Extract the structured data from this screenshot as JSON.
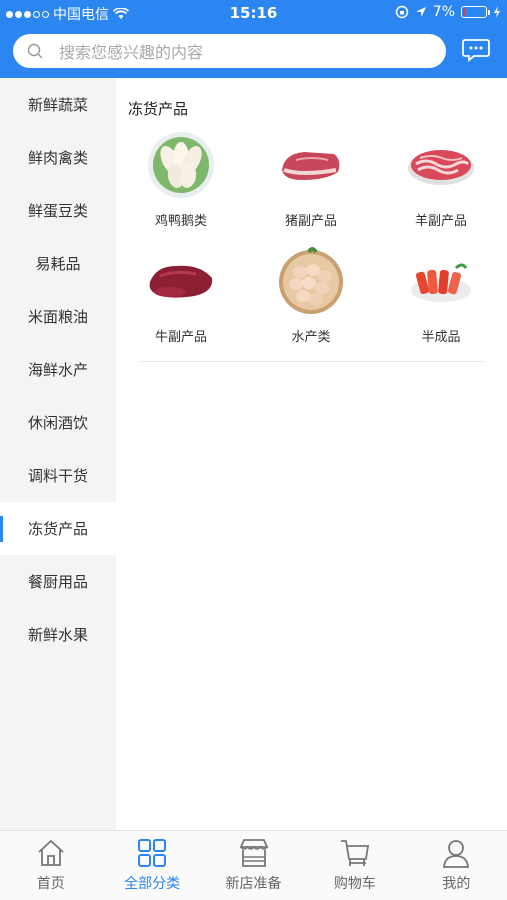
{
  "status_bar": {
    "carrier": "中国电信",
    "time": "15:16",
    "battery": "7%"
  },
  "search": {
    "placeholder": "搜索您感兴趣的内容"
  },
  "colors": {
    "primary": "#2b86f2",
    "sidebar_bg": "#f4f4f6"
  },
  "sidebar": {
    "items": [
      {
        "label": "新鲜蔬菜"
      },
      {
        "label": "鲜肉禽类"
      },
      {
        "label": "鲜蛋豆类"
      },
      {
        "label": "易耗品"
      },
      {
        "label": "米面粮油"
      },
      {
        "label": "海鲜水产"
      },
      {
        "label": "休闲酒饮"
      },
      {
        "label": "调料干货"
      },
      {
        "label": "冻货产品",
        "active": true
      },
      {
        "label": "餐厨用品"
      },
      {
        "label": "新鲜水果"
      }
    ]
  },
  "category": {
    "title": "冻货产品",
    "products": [
      {
        "label": "鸡鸭鹅类",
        "icon": "poultry-image"
      },
      {
        "label": "猪副产品",
        "icon": "pork-image"
      },
      {
        "label": "羊副产品",
        "icon": "mutton-image"
      },
      {
        "label": "牛副产品",
        "icon": "beef-image"
      },
      {
        "label": "水产类",
        "icon": "eggs-image"
      },
      {
        "label": "半成品",
        "icon": "semi-finished-image"
      }
    ]
  },
  "tabbar": {
    "tabs": [
      {
        "label": "首页",
        "icon": "home-icon"
      },
      {
        "label": "全部分类",
        "icon": "grid-icon",
        "active": true
      },
      {
        "label": "新店准备",
        "icon": "store-icon"
      },
      {
        "label": "购物车",
        "icon": "cart-icon"
      },
      {
        "label": "我的",
        "icon": "user-icon"
      }
    ]
  }
}
